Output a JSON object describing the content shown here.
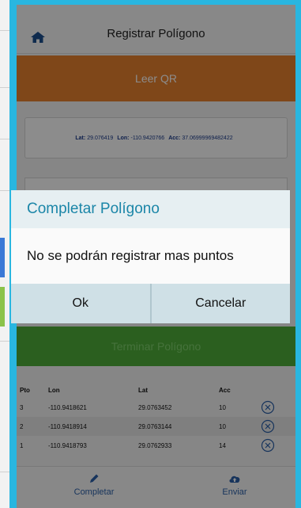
{
  "header": {
    "title": "Registrar Polígono"
  },
  "qr_button": {
    "label": "Leer QR"
  },
  "location": {
    "lat_label": "Lat:",
    "lat_value": "29.076419",
    "lon_label": "Lon:",
    "lon_value": "-110.9420766",
    "acc_label": "Acc:",
    "acc_value": "37.06999969482422"
  },
  "finish_button": {
    "label": "Terminar Polígono"
  },
  "table": {
    "headers": {
      "pto": "Pto",
      "lon": "Lon",
      "lat": "Lat",
      "acc": "Acc"
    },
    "rows": [
      {
        "pto": "3",
        "lon": "-110.9418621",
        "lat": "29.0763452",
        "acc": "10"
      },
      {
        "pto": "2",
        "lon": "-110.9418914",
        "lat": "29.0763144",
        "acc": "10"
      },
      {
        "pto": "1",
        "lon": "-110.9418793",
        "lat": "29.0762933",
        "acc": "14"
      }
    ]
  },
  "footer": {
    "complete_label": "Completar",
    "send_label": "Enviar"
  },
  "dialog": {
    "title": "Completar Polígono",
    "message": "No se podrán registrar mas puntos",
    "ok_label": "Ok",
    "cancel_label": "Cancelar"
  },
  "colors": {
    "frame": "#29b6e0",
    "qr_button": "#e8812e",
    "finish_button": "#4fae3a",
    "dialog_title": "#1b86a8",
    "footer_icons": "#2a5fa8"
  },
  "icons": {
    "home": "home-icon",
    "remove": "circle-x-icon",
    "complete": "pencil-icon",
    "send": "cloud-upload-icon"
  }
}
